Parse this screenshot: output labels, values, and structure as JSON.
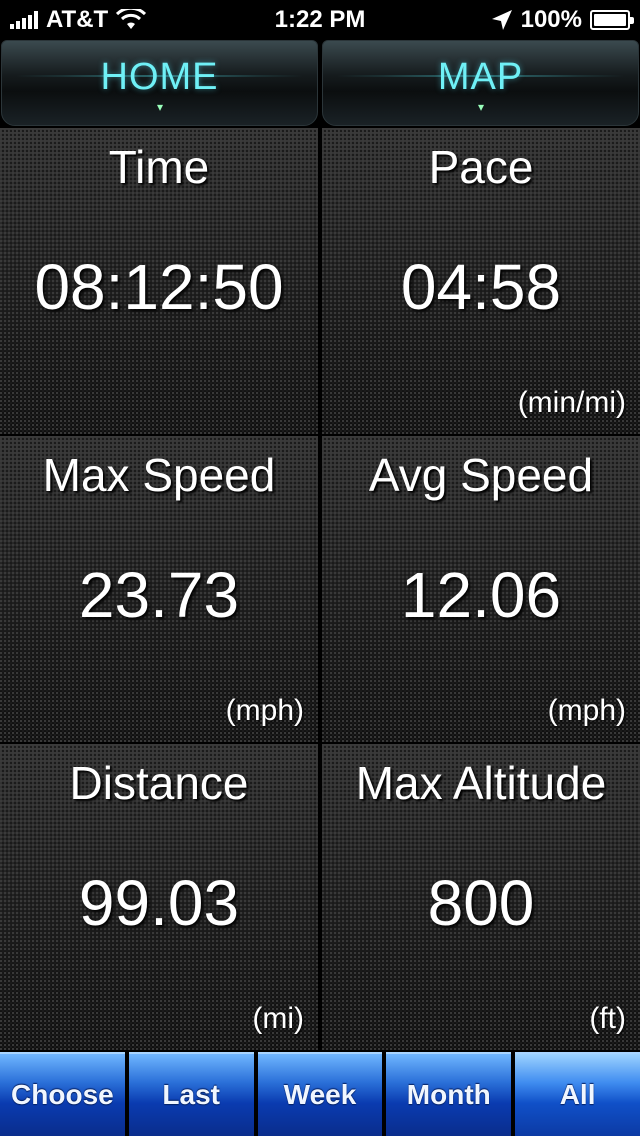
{
  "status_bar": {
    "carrier": "AT&T",
    "time": "1:22 PM",
    "battery": "100%",
    "icons": [
      "signal-icon",
      "wifi-icon",
      "location-arrow-icon",
      "battery-icon"
    ]
  },
  "nav": {
    "tabs": [
      {
        "label": "HOME"
      },
      {
        "label": "MAP"
      }
    ]
  },
  "stats": [
    {
      "label": "Time",
      "value": "08:12:50",
      "unit": ""
    },
    {
      "label": "Pace",
      "value": "04:58",
      "unit": "(min/mi)"
    },
    {
      "label": "Max Speed",
      "value": "23.73",
      "unit": "(mph)"
    },
    {
      "label": "Avg Speed",
      "value": "12.06",
      "unit": "(mph)"
    },
    {
      "label": "Distance",
      "value": "99.03",
      "unit": "(mi)"
    },
    {
      "label": "Max Altitude",
      "value": "800",
      "unit": "(ft)"
    }
  ],
  "filters": [
    {
      "label": "Choose"
    },
    {
      "label": "Last"
    },
    {
      "label": "Week"
    },
    {
      "label": "Month"
    },
    {
      "label": "All"
    }
  ],
  "colors": {
    "nav_text": "#6ff0f6",
    "filter_blue": "#2a6fd8"
  }
}
